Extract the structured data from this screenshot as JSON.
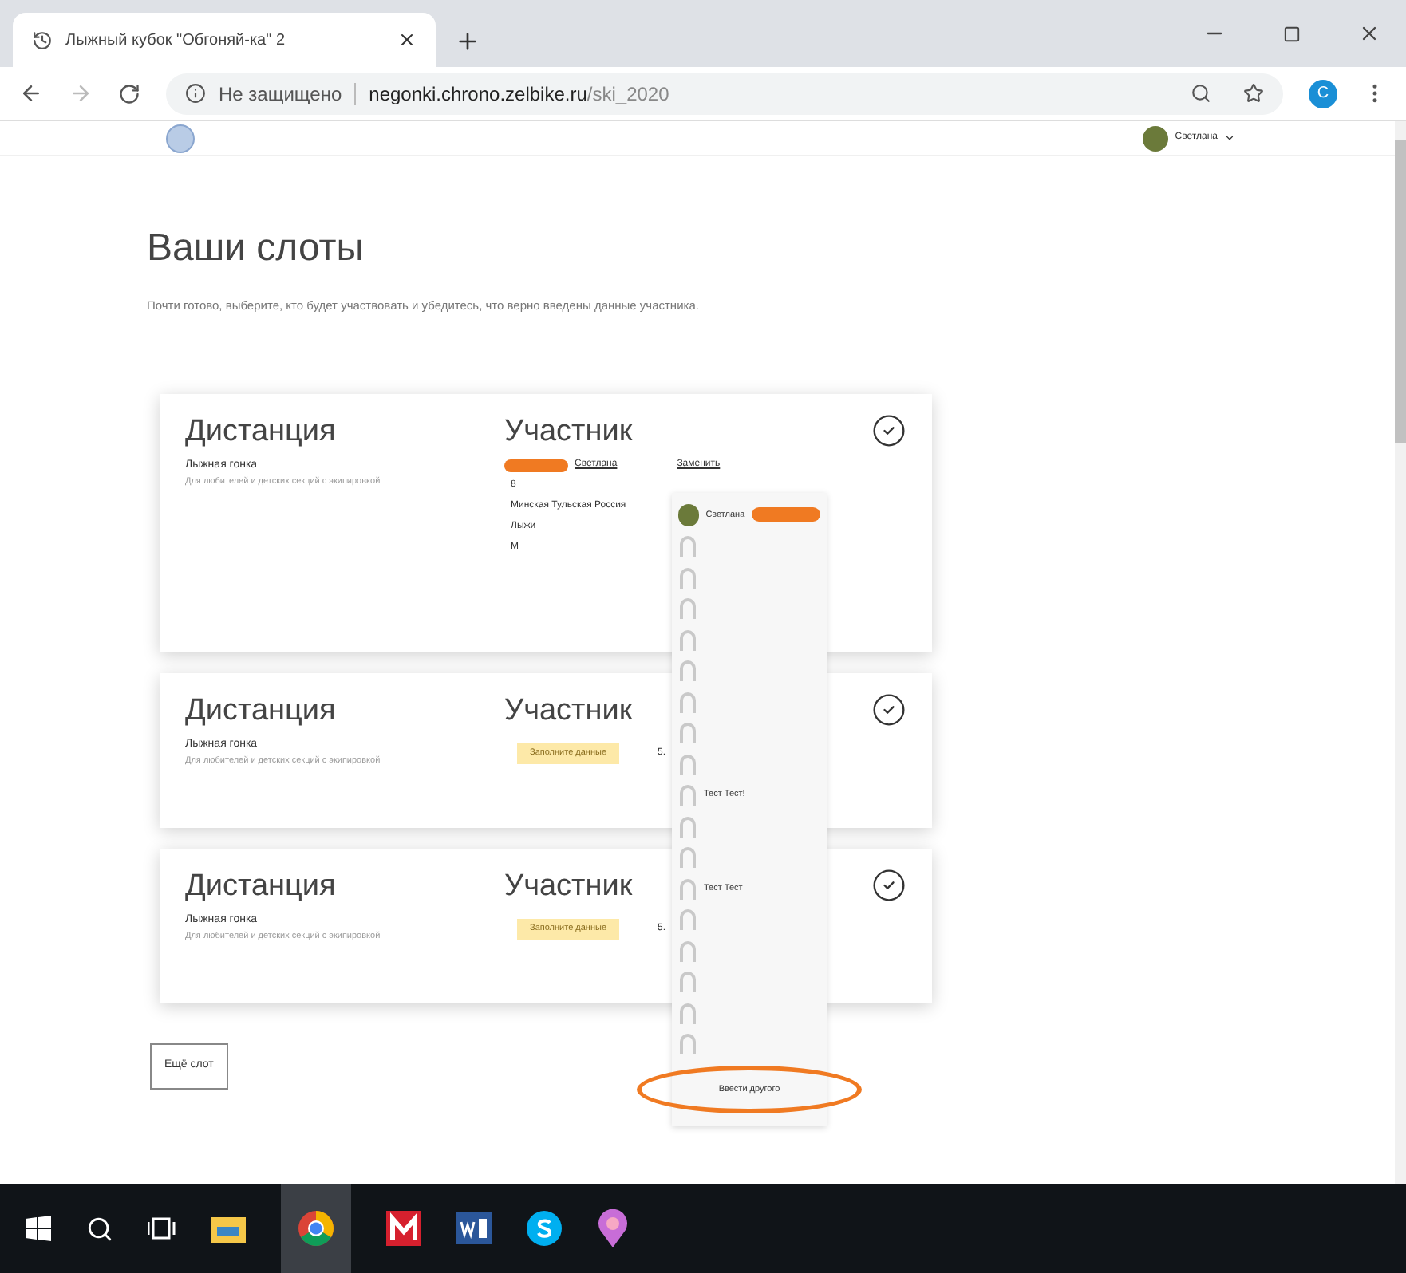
{
  "browser": {
    "tab_title": "Лыжный кубок \"Обгоняй-ка\" 2",
    "security": "Не защищено",
    "url_host": "negonki.chrono.zelbike.ru",
    "url_path": "/ski_2020",
    "profile_initial": "С"
  },
  "header": {
    "user": "Светлана"
  },
  "page": {
    "title": "Ваши слоты",
    "subtitle": "Почти готово, выберите, кто будет участвовать и убедитесь, что верно введены данные участника."
  },
  "slots": [
    {
      "distance_label": "Дистанция",
      "race": "Лыжная гонка",
      "description": "Для любителей и детских секций с экипировкой",
      "participant_label": "Участник",
      "done": true,
      "kind": "filled",
      "person": "Светлана",
      "details": [
        "8",
        "Минская Тульская Россия",
        "Лыжи",
        "М"
      ],
      "change_label": "Заменить"
    },
    {
      "distance_label": "Дистанция",
      "race": "Лыжная гонка",
      "description": "Для любителей и детских секций с экипировкой",
      "participant_label": "Участник",
      "done": true,
      "kind": "empty",
      "badge": "Заполните данные",
      "hint": "5."
    },
    {
      "distance_label": "Дистанция",
      "race": "Лыжная гонка",
      "description": "Для любителей и детских секций с экипировкой",
      "participant_label": "Участник",
      "done": true,
      "kind": "empty",
      "badge": "Заполните данные",
      "hint": "5."
    }
  ],
  "dropdown": {
    "items": [
      {
        "kind": "avatar",
        "label": "Светлана"
      },
      {
        "kind": "blank"
      },
      {
        "kind": "blank"
      },
      {
        "kind": "blank"
      },
      {
        "kind": "blank"
      },
      {
        "kind": "blank"
      },
      {
        "kind": "blank"
      },
      {
        "kind": "blank"
      },
      {
        "kind": "blank"
      },
      {
        "kind": "blank",
        "label": "Тест Тест!"
      },
      {
        "kind": "blank"
      },
      {
        "kind": "blank"
      },
      {
        "kind": "blank",
        "label": "Тест Тест"
      },
      {
        "kind": "blank"
      },
      {
        "kind": "blank"
      },
      {
        "kind": "blank"
      },
      {
        "kind": "blank"
      },
      {
        "kind": "blank"
      }
    ],
    "other_button": "Ввести другого"
  },
  "add_slot_button": "Ещё слот"
}
